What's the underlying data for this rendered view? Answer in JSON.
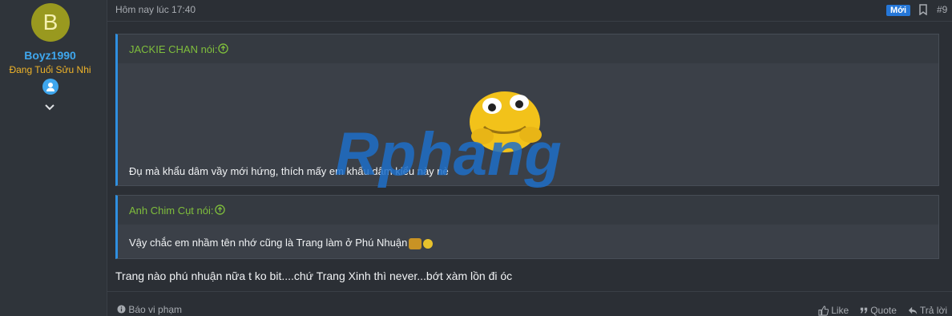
{
  "user": {
    "avatar_letter": "B",
    "name": "Boyz1990",
    "title": "Đang Tuổi Sửu Nhi"
  },
  "post": {
    "time": "Hôm nay lúc 17:40",
    "new_badge": "Mới",
    "number": "#9",
    "quotes": [
      {
        "author": "JACKIE CHAN nói:",
        "text": "Đụ mà khẩu dâm vầy mới hứng, thích mấy em khẩu dâm kiểu này nè"
      },
      {
        "author": "Anh Chim Cụt nói:",
        "text": "Vậy chắc em nhầm tên nhớ cũng là Trang làm ở Phú Nhuận"
      }
    ],
    "body": "Trang nào phú nhuận nữa t ko bit....chứ Trang Xinh thì never...bớt xàm lồn đi óc"
  },
  "footer": {
    "report": "Báo vi phạm",
    "like": "Like",
    "quote": "Quote",
    "reply": "Trả lời"
  },
  "watermark": {
    "text": "Rphang"
  },
  "colors": {
    "accent": "#2f8fe0",
    "quote_author": "#7fbe3c",
    "username": "#3fa7ee",
    "user_title": "#f0b429",
    "avatar": "#99991f"
  }
}
